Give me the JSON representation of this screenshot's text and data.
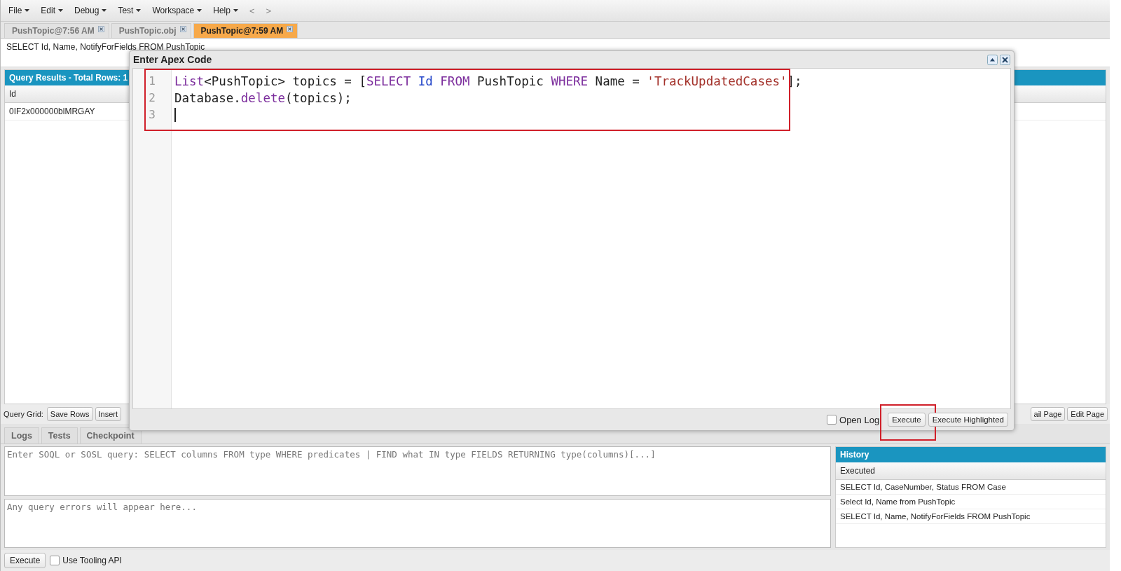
{
  "menu": [
    {
      "label": "File"
    },
    {
      "label": "Edit"
    },
    {
      "label": "Debug"
    },
    {
      "label": "Test"
    },
    {
      "label": "Workspace"
    },
    {
      "label": "Help"
    }
  ],
  "nav": [
    "<",
    ">"
  ],
  "editor_tabs": [
    {
      "label": "PushTopic@7:56 AM",
      "selected": false
    },
    {
      "label": "PushTopic.obj",
      "selected": false
    },
    {
      "label": "PushTopic@7:59 AM",
      "selected": true
    }
  ],
  "query_text": "SELECT Id, Name, NotifyForFields FROM PushTopic",
  "query_results": {
    "title": "Query Results - Total Rows: 1",
    "columns": [
      "Id"
    ],
    "rows": [
      [
        "0IF2x000000blMRGAY"
      ]
    ]
  },
  "query_grid": {
    "label": "Query Grid:",
    "left_buttons": [
      "Save Rows",
      "Insert"
    ],
    "right_buttons": [
      "ail Page",
      "Edit Page"
    ]
  },
  "bottom_tabs": [
    {
      "label": "Logs",
      "selected": false
    },
    {
      "label": "Tests",
      "selected": false
    },
    {
      "label": "Checkpoint",
      "selected": false
    }
  ],
  "soql_input": {
    "placeholder": "Enter SOQL or SOSL query: SELECT columns FROM type WHERE predicates | FIND what IN type FIELDS RETURNING type(columns)[...]"
  },
  "errors_box": {
    "placeholder": "Any query errors will appear here..."
  },
  "history": {
    "title": "History",
    "column": "Executed",
    "rows": [
      "SELECT Id, CaseNumber, Status FROM Case",
      "Select Id, Name from PushTopic",
      "SELECT Id, Name, NotifyForFields FROM PushTopic"
    ]
  },
  "footer": {
    "execute": "Execute",
    "use_tooling_api": {
      "label": "Use Tooling API",
      "checked": false
    }
  },
  "dialog": {
    "title": "Enter Apex Code",
    "lines": [
      {
        "number": "1",
        "tokens": [
          {
            "text": "List",
            "kind": "keyword"
          },
          {
            "text": "<PushTopic> topics = [",
            "kind": "plain"
          },
          {
            "text": "SELECT",
            "kind": "keyword"
          },
          {
            "text": " Id",
            "kind": "field"
          },
          {
            "text": " FROM",
            "kind": "keyword"
          },
          {
            "text": " PushTopic ",
            "kind": "plain"
          },
          {
            "text": "WHERE",
            "kind": "keyword"
          },
          {
            "text": " Name = ",
            "kind": "plain"
          },
          {
            "text": "'TrackUpdatedCases'",
            "kind": "string"
          },
          {
            "text": "];",
            "kind": "plain"
          }
        ]
      },
      {
        "number": "2",
        "tokens": [
          {
            "text": "Database.",
            "kind": "plain"
          },
          {
            "text": "delete",
            "kind": "keyword"
          },
          {
            "text": "(topics);",
            "kind": "plain"
          }
        ]
      },
      {
        "number": "3",
        "cursor": true
      }
    ],
    "open_log": {
      "label": "Open Log",
      "checked": false
    },
    "buttons": [
      "Execute",
      "Execute Highlighted"
    ]
  }
}
